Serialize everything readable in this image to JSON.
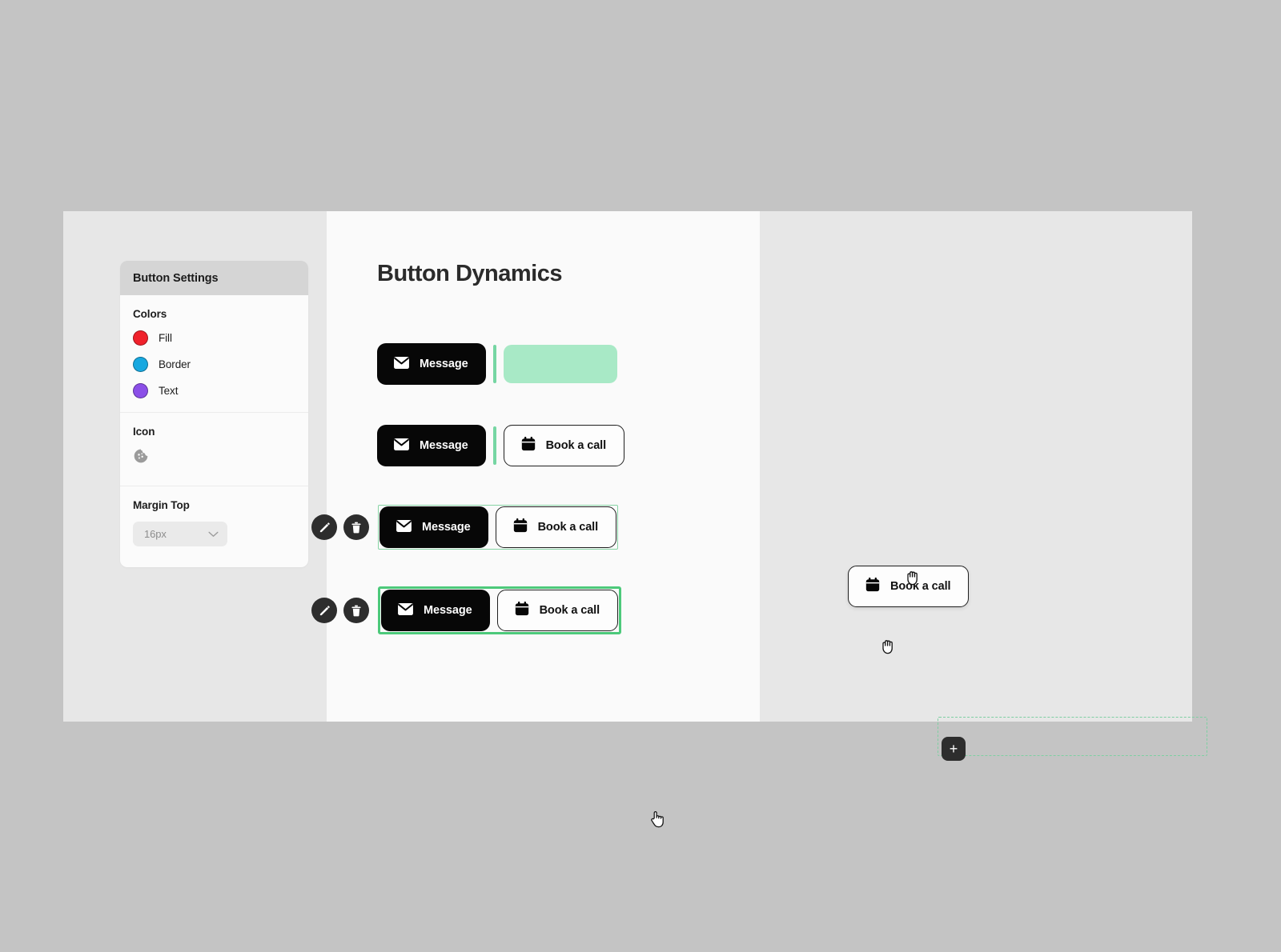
{
  "window": {
    "background_outer": "#c4c4c4",
    "background_panel": "#e7e7e7",
    "background_canvas": "#fafafa"
  },
  "settings_panel": {
    "title": "Button Settings",
    "colors": {
      "section_title": "Colors",
      "items": [
        {
          "label": "Fill",
          "color": "#f0212b"
        },
        {
          "label": "Border",
          "color": "#17a8e0"
        },
        {
          "label": "Text",
          "color": "#8b4fe8"
        }
      ]
    },
    "icon": {
      "section_title": "Icon",
      "icon_name": "cookie-icon",
      "icon_color": "#9b9b9b"
    },
    "margin_top": {
      "section_title": "Margin Top",
      "value": "16px",
      "chevron": "chevron-down-icon"
    }
  },
  "canvas": {
    "title": "Button Dynamics",
    "accent_green": "#4cc97a",
    "placeholder_green": "#a8e9c6",
    "divider_green": "#76d6a3",
    "rows": [
      {
        "name": "row-dragging",
        "message_label": "Message",
        "book_label": "Book a call",
        "state": "dragging",
        "cursor": "grabbing-hand-cursor"
      },
      {
        "name": "row-hover",
        "message_label": "Message",
        "book_label": "Book a call",
        "state": "hover",
        "cursor": "grab-hand-cursor"
      },
      {
        "name": "row-selected-dropzone",
        "message_label": "Message",
        "book_label": "Book a call",
        "state": "selected-thin",
        "edit_icon": "pencil-icon",
        "delete_icon": "trash-icon",
        "add_icon": "plus-icon"
      },
      {
        "name": "row-selected-active",
        "message_label": "Message",
        "book_label": "Book a call",
        "state": "selected-thick",
        "edit_icon": "pencil-icon",
        "delete_icon": "trash-icon",
        "cursor": "pointing-hand-cursor"
      }
    ],
    "icons": {
      "message": "envelope-icon",
      "book": "calendar-icon"
    }
  }
}
